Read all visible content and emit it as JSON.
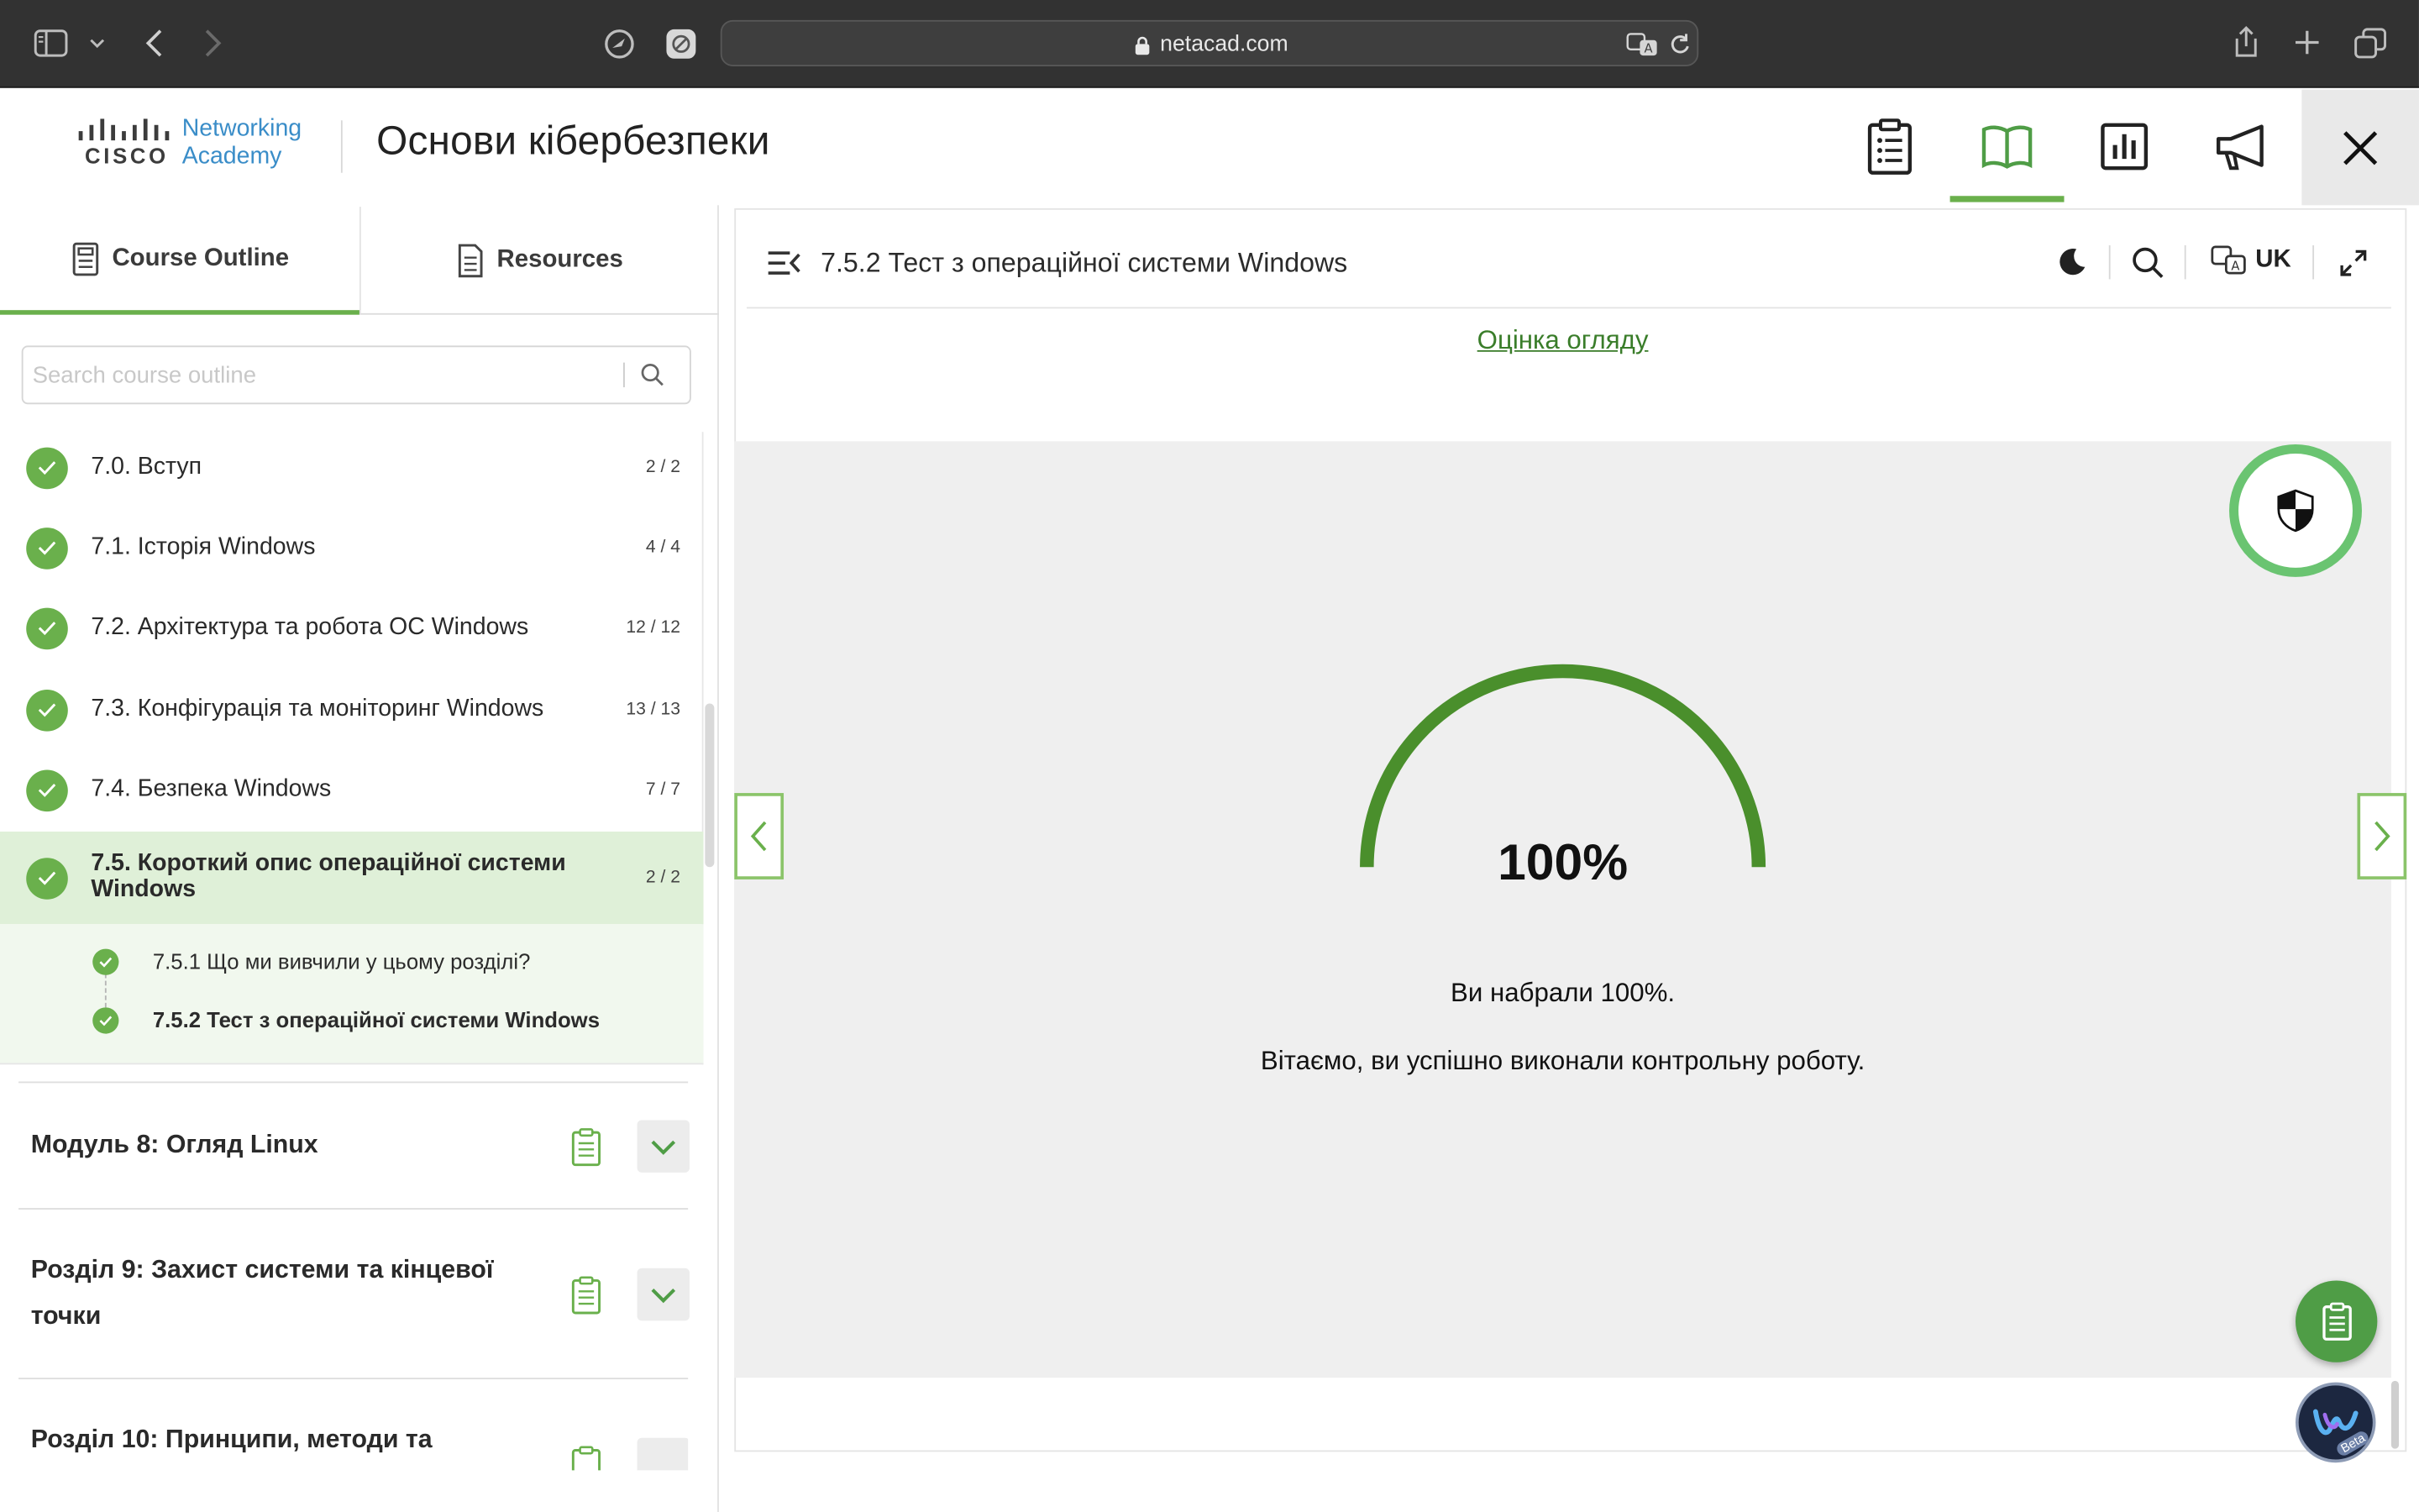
{
  "browser": {
    "url": "netacad.com"
  },
  "header": {
    "logo_line1": "Networking",
    "logo_line2": "Academy",
    "logo_brand": "CISCO",
    "course_title": "Основи кібербезпеки"
  },
  "left_panel": {
    "tabs": [
      {
        "label": "Course Outline",
        "active": true
      },
      {
        "label": "Resources",
        "active": false
      }
    ],
    "search_placeholder": "Search course outline",
    "sections": [
      {
        "label": "7.0. Вступ",
        "count": "2 / 2"
      },
      {
        "label": "7.1. Історія Windows",
        "count": "4 / 4"
      },
      {
        "label": "7.2. Архітектура та робота ОС Windows",
        "count": "12 / 12"
      },
      {
        "label": "7.3. Конфігурація та моніторинг Windows",
        "count": "13 / 13"
      },
      {
        "label": "7.4. Безпека Windows",
        "count": "7 / 7"
      },
      {
        "label_line1": "7.5. Короткий опис операційної системи",
        "label_line2": "Windows",
        "count": "2 / 2"
      }
    ],
    "subitems": [
      {
        "label": "7.5.1 Що ми вивчили у цьому розділі?"
      },
      {
        "label": "7.5.2 Тест з операційної системи Windows"
      }
    ],
    "modules": [
      {
        "title": "Модуль 8: Огляд Linux"
      },
      {
        "title_line1": "Розділ 9: Захист системи та кінцевої",
        "title_line2": "точки"
      },
      {
        "title": "Розділ 10: Принципи, методи та"
      }
    ]
  },
  "content": {
    "page_title": "7.5.2 Тест з операційної системи Windows",
    "language": "UK",
    "review_link": "Оцінка огляду",
    "score_percent": 100,
    "score_label": "100%",
    "message_score": "Ви набрали 100%.",
    "message_congrats": "Вітаємо, ви успішно виконали контрольну роботу.",
    "beta_badge": "Beta"
  },
  "colors": {
    "accent_green": "#6ab04c",
    "gauge_green": "#4a8f2c",
    "link_green": "#3a7d2a"
  }
}
